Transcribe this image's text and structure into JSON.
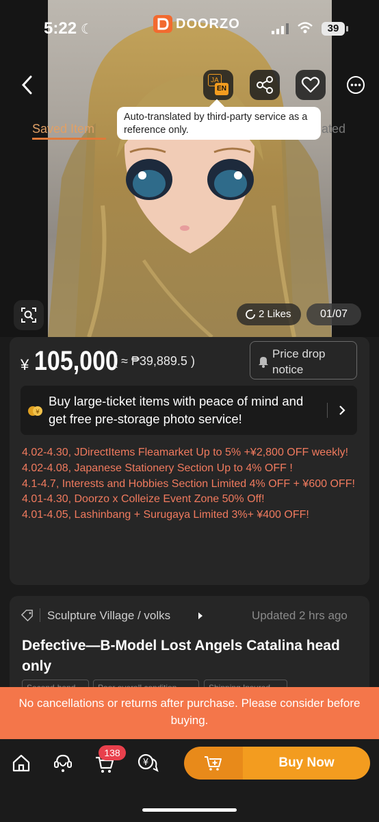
{
  "status_bar": {
    "time": "5:22",
    "battery": "39"
  },
  "app": {
    "logo_text": "DOORZO"
  },
  "top_actions": {
    "translate_ja": "JA",
    "translate_en": "EN"
  },
  "tooltip": {
    "text": "Auto-translated by third-party service as a reference only."
  },
  "tabs": {
    "saved": "Saved Item",
    "related_tail": "ated"
  },
  "gallery": {
    "likes": "2 Likes",
    "page_indicator": "01/07"
  },
  "price": {
    "currency_symbol": "¥",
    "amount": "105,000",
    "converted": "( ≈ ₱39,889.5 )",
    "drop_notice": "Price drop notice"
  },
  "promo_banner": {
    "text": "Buy large-ticket items with peace of mind and get free pre-storage photo service!"
  },
  "promotions": [
    "4.02-4.30, JDirectItems Fleamarket Up to 5% +¥2,800 OFF weekly!",
    "4.02-4.08, Japanese Stationery Section Up to 4% OFF !",
    "4.1-4.7, Interests and Hobbies Section  Limited 4% OFF + ¥600 OFF!",
    "4.01-4.30, Doorzo x Colleize Event Zone 50% Off!",
    "4.01-4.05,  Lashinbang + Surugaya Limited 3%+ ¥400 OFF!"
  ],
  "product": {
    "category": "Sculpture Village / volks",
    "updated": "Updated 2 hrs ago",
    "title": "Defective—B-Model Lost Angels Catalina head only",
    "chips": [
      "Second-hand",
      "Poor overall condition",
      "Shipping Insured"
    ]
  },
  "warning": {
    "text": "No cancellations or returns after purchase. Please consider before buying."
  },
  "bottom_bar": {
    "cart_count": "138",
    "buy_now": "Buy Now"
  },
  "colors": {
    "accent": "#f39c1f",
    "warning": "#f4764a",
    "promo_text": "#f07a5e",
    "badge": "#e8404c"
  }
}
